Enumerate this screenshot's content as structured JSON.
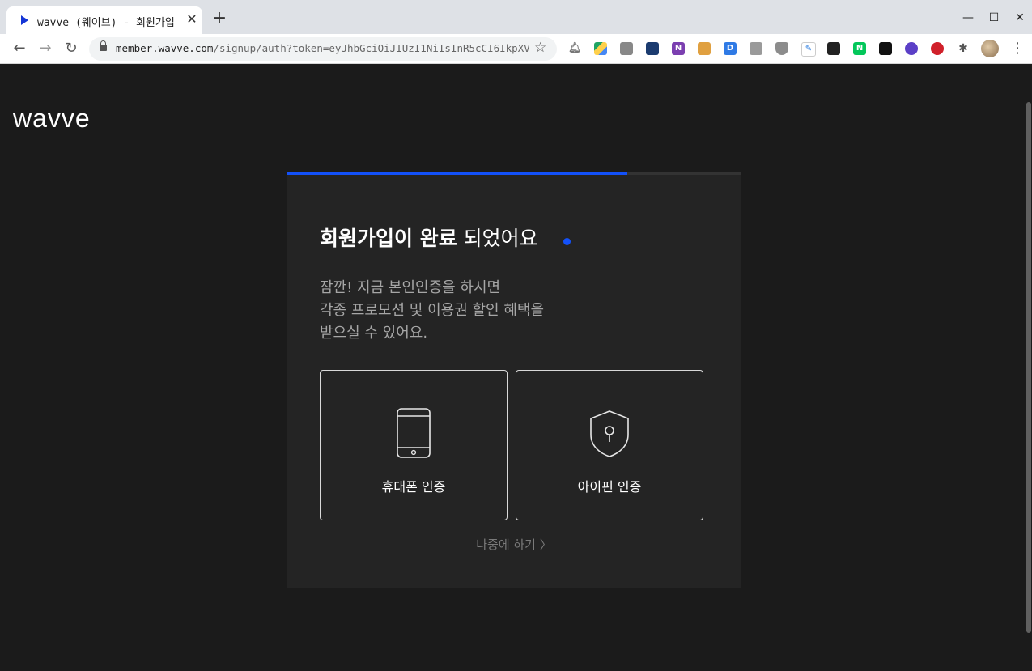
{
  "browser": {
    "tab_title": "wavve (웨이브) - 회원가입",
    "new_tab_label": "+",
    "url_host": "member.wavve.com",
    "url_path": "/signup/auth?token=eyJhbGciOiJIUzI1NiIsInR5cCI6IkpXVCJ9..."
  },
  "page": {
    "logo": "wavve",
    "progress": 0.75,
    "headline_bold": "회원가입이 완료",
    "headline_light": " 되었어요",
    "description": [
      "잠깐! 지금 본인인증을 하시면",
      "각종 프로모션 및 이용권 할인 혜택을",
      "받으실 수 있어요."
    ],
    "options": [
      {
        "label": "휴대폰 인증",
        "icon": "smartphone-icon"
      },
      {
        "label": "아이핀 인증",
        "icon": "shield-keyhole-icon"
      }
    ],
    "later": "나중에 하기 〉",
    "colors": {
      "accent": "#1351f9",
      "background": "#1b1b1b",
      "card": "#242424"
    }
  }
}
